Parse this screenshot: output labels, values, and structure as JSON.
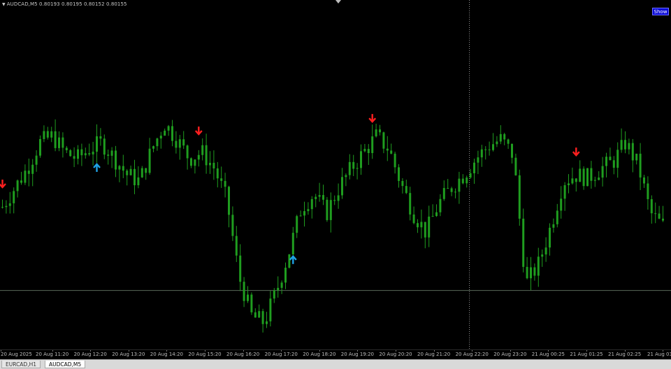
{
  "header": {
    "symbol_info": "AUDCAD,M5  0.80193 0.80195 0.80152 0.80155"
  },
  "show_button": {
    "label": "Show"
  },
  "tabs": [
    {
      "label": "EURCAD,H1",
      "active": false
    },
    {
      "label": "AUDCAD,M5",
      "active": true
    }
  ],
  "colors": {
    "candle": "#1f9d1f",
    "sell_arrow": "#ff1f1f",
    "buy_arrow": "#1fa3e6",
    "hline": "#5a6a5a",
    "vline": "#9a9a9a"
  },
  "chart_data": {
    "type": "candlestick",
    "symbol": "AUDCAD",
    "timeframe": "M5",
    "ohlc": {
      "open": 0.80193,
      "high": 0.80195,
      "low": 0.80152,
      "close": 0.80155
    },
    "time_ticks": [
      "20 Aug 2025",
      "20 Aug 11:20",
      "20 Aug 12:20",
      "20 Aug 13:20",
      "20 Aug 14:20",
      "20 Aug 15:20",
      "20 Aug 16:20",
      "20 Aug 17:20",
      "20 Aug 18:20",
      "20 Aug 19:20",
      "20 Aug 20:20",
      "20 Aug 21:20",
      "20 Aug 22:20",
      "20 Aug 23:20",
      "21 Aug 00:25",
      "21 Aug 01:25",
      "21 Aug 02:25",
      "21 Aug 03:25"
    ],
    "close_profile": [
      0.4,
      0.46,
      0.52,
      0.6,
      0.62,
      0.57,
      0.55,
      0.58,
      0.6,
      0.55,
      0.5,
      0.48,
      0.58,
      0.66,
      0.61,
      0.55,
      0.57,
      0.52,
      0.42,
      0.18,
      0.06,
      0.04,
      0.14,
      0.26,
      0.4,
      0.44,
      0.38,
      0.46,
      0.52,
      0.57,
      0.62,
      0.58,
      0.47,
      0.38,
      0.32,
      0.41,
      0.46,
      0.5,
      0.55,
      0.59,
      0.61,
      0.56,
      0.16,
      0.22,
      0.34,
      0.48,
      0.5,
      0.49,
      0.52,
      0.54,
      0.6,
      0.53,
      0.38,
      0.34
    ],
    "signals": [
      {
        "type": "sell",
        "index": 0
      },
      {
        "type": "buy",
        "index": 25
      },
      {
        "type": "sell",
        "index": 52
      },
      {
        "type": "buy",
        "index": 77
      },
      {
        "type": "sell",
        "index": 98
      },
      {
        "type": "sell",
        "index": 152
      }
    ],
    "reference_price_level": 0.14,
    "current_bar_marker_index": 124,
    "grid": false
  }
}
